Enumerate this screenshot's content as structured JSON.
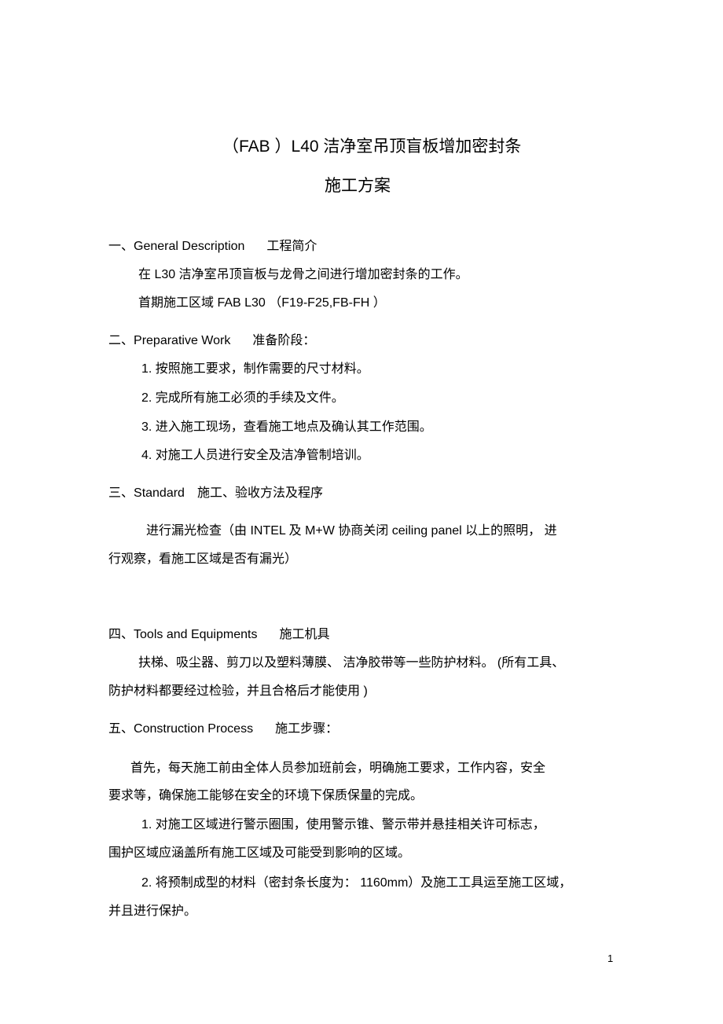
{
  "document": {
    "title_line1": "（FAB ）L40  洁净室吊顶盲板增加密封条",
    "title_line2": "施工方案",
    "sections": [
      {
        "number": "一、",
        "title_en": "General Description",
        "title_cn": "工程简介",
        "lines": [
          "在 L30 洁净室吊顶盲板与龙骨之间进行增加密封条的工作。",
          "首期施工区域  FAB L30 （F19-F25,FB-FH  ）"
        ]
      },
      {
        "number": "二、",
        "title_en": "Preparative Work",
        "title_cn": "准备阶段：",
        "items": [
          "1. 按照施工要求，制作需要的尺寸材料。",
          "2. 完成所有施工必须的手续及文件。",
          "3. 进入施工现场，查看施工地点及确认其工作范围。",
          "4. 对施工人员进行安全及洁净管制培训。"
        ]
      },
      {
        "number": "三、",
        "title_en": "Standard",
        "title_cn": "施工、验收方法及程序",
        "lines": [
          "进行漏光检查（由  INTEL  及 M+W  协商关闭  ceiling panel    以上的照明，  进",
          "行观察，看施工区域是否有漏光）"
        ]
      },
      {
        "number": "四、",
        "title_en": "Tools and Equipments",
        "title_cn": "施工机具",
        "lines": [
          "扶梯、吸尘器、剪刀以及塑料薄膜、  洁净胶带等一些防护材料。     (所有工具、",
          "防护材料都要经过检验，并且合格后才能使用       )"
        ]
      },
      {
        "number": "五、",
        "title_en": "Construction Process",
        "title_cn": "施工步骤：",
        "lines": [
          "首先，每天施工前由全体人员参加班前会，明确施工要求，工作内容，安全",
          "要求等，确保施工能够在安全的环境下保质保量的完成。",
          "1. 对施工区域进行警示圈围，使用警示锥、警示带并悬挂相关许可标志，",
          "围护区域应涵盖所有施工区域及可能受到影响的区域。",
          "2. 将预制成型的材料（密封条长度为：  1160mm）及施工工具运至施工区域，",
          "并且进行保护。"
        ]
      }
    ],
    "page_number": "1"
  }
}
